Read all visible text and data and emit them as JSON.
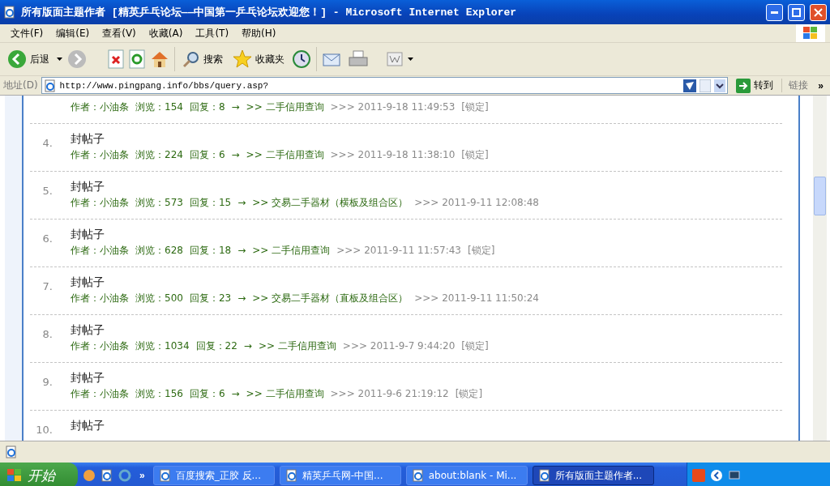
{
  "window": {
    "title": "所有版面主题作者 [精英乒乓论坛——中国第一乒乓论坛欢迎您！] - Microsoft Internet Explorer"
  },
  "menu": [
    "文件(F)",
    "编辑(E)",
    "查看(V)",
    "收藏(A)",
    "工具(T)",
    "帮助(H)"
  ],
  "toolbar": {
    "back": "后退",
    "search": "搜索",
    "favorites": "收藏夹"
  },
  "address": {
    "label": "地址(D)",
    "value": "http://www.pingpang.info/bbs/query.asp?",
    "go": "转到",
    "links": "链接",
    "more": "»"
  },
  "posts": [
    {
      "author": "作者：小油条",
      "views": "浏览：154",
      "replies": "回复：8",
      "arrow": "→",
      "forum": ">> 二手信用查询",
      "time": ">>> 2011-9-18 11:49:53",
      "tag": "[锁定]"
    },
    {
      "number": "4.",
      "title": "封帖子",
      "author": "作者：小油条",
      "views": "浏览：224",
      "replies": "回复：6",
      "arrow": "→",
      "forum": ">> 二手信用查询",
      "time": ">>> 2011-9-18 11:38:10",
      "tag": "[锁定]"
    },
    {
      "number": "5.",
      "title": "封帖子",
      "author": "作者：小油条",
      "views": "浏览：573",
      "replies": "回复：15",
      "arrow": "→",
      "forum": ">> 交易二手器材（横板及组合区）",
      "time": ">>> 2011-9-11 12:08:48"
    },
    {
      "number": "6.",
      "title": "封帖子",
      "author": "作者：小油条",
      "views": "浏览：628",
      "replies": "回复：18",
      "arrow": "→",
      "forum": ">> 二手信用查询",
      "time": ">>> 2011-9-11 11:57:43",
      "tag": "[锁定]"
    },
    {
      "number": "7.",
      "title": "封帖子",
      "author": "作者：小油条",
      "views": "浏览：500",
      "replies": "回复：23",
      "arrow": "→",
      "forum": ">> 交易二手器材（直板及组合区）",
      "time": ">>> 2011-9-11 11:50:24"
    },
    {
      "number": "8.",
      "title": "封帖子",
      "author": "作者：小油条",
      "views": "浏览：1034",
      "replies": "回复：22",
      "arrow": "→",
      "forum": ">> 二手信用查询",
      "time": ">>> 2011-9-7 9:44:20",
      "tag": "[锁定]"
    },
    {
      "number": "9.",
      "title": "封帖子",
      "author": "作者：小油条",
      "views": "浏览：156",
      "replies": "回复：6",
      "arrow": "→",
      "forum": ">> 二手信用查询",
      "time": ">>> 2011-9-6 21:19:12",
      "tag": "[锁定]"
    },
    {
      "number": "10.",
      "title": "封帖子"
    }
  ],
  "taskbar": {
    "start": "开始",
    "more": "»",
    "tasks": [
      {
        "label": "百度搜索_正胶 反...",
        "selected": false
      },
      {
        "label": "精英乒乓网-中国...",
        "selected": false
      },
      {
        "label": "about:blank - Mi...",
        "selected": false
      },
      {
        "label": "所有版面主题作者...",
        "selected": true
      }
    ]
  }
}
